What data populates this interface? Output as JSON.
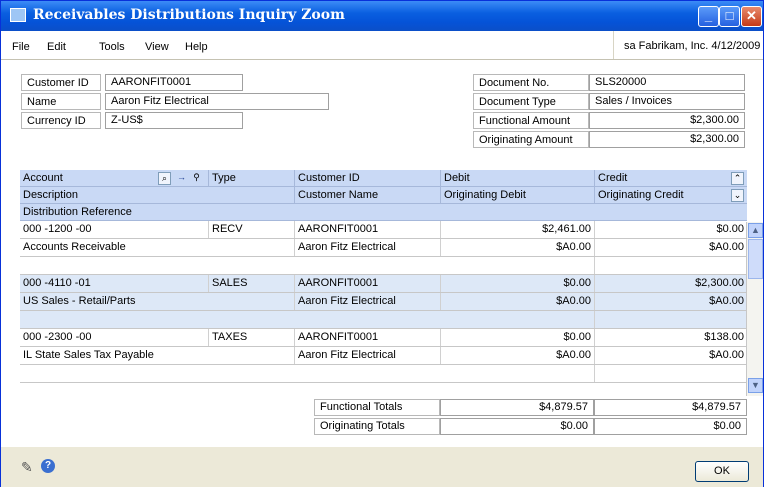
{
  "window": {
    "title": "Receivables Distributions Inquiry Zoom",
    "company_date": "sa  Fabrikam, Inc.  4/12/2009"
  },
  "menu": [
    "File",
    "Edit",
    "Tools",
    "View",
    "Help"
  ],
  "header_left": {
    "customer_id_label": "Customer ID",
    "customer_id": "AARONFIT0001",
    "name_label": "Name",
    "name": "Aaron Fitz Electrical",
    "currency_label": "Currency ID",
    "currency": "Z-US$"
  },
  "header_right": {
    "doc_no_label": "Document No.",
    "doc_no": "SLS20000",
    "doc_type_label": "Document Type",
    "doc_type": "Sales / Invoices",
    "func_label": "Functional Amount",
    "func": "$2,300.00",
    "orig_label": "Originating Amount",
    "orig": "$2,300.00"
  },
  "columns": {
    "account": "Account",
    "type": "Type",
    "customer_id": "Customer ID",
    "debit": "Debit",
    "credit": "Credit",
    "description": "Description",
    "customer_name": "Customer Name",
    "orig_debit": "Originating Debit",
    "orig_credit": "Originating Credit",
    "dist_ref": "Distribution Reference"
  },
  "rows": [
    {
      "account": "000 -1200 -00",
      "type": "RECV",
      "customer_id": "AARONFIT0001",
      "debit": "$2,461.00",
      "credit": "$0.00",
      "description": "Accounts Receivable",
      "customer_name": "Aaron Fitz Electrical",
      "orig_debit": "$A0.00",
      "orig_credit": "$A0.00"
    },
    {
      "account": "000 -4110 -01",
      "type": "SALES",
      "customer_id": "AARONFIT0001",
      "debit": "$0.00",
      "credit": "$2,300.00",
      "description": "US Sales - Retail/Parts",
      "customer_name": "Aaron Fitz Electrical",
      "orig_debit": "$A0.00",
      "orig_credit": "$A0.00"
    },
    {
      "account": "000 -2300 -00",
      "type": "TAXES",
      "customer_id": "AARONFIT0001",
      "debit": "$0.00",
      "credit": "$138.00",
      "description": "IL State Sales Tax Payable",
      "customer_name": "Aaron Fitz Electrical",
      "orig_debit": "$A0.00",
      "orig_credit": "$A0.00"
    }
  ],
  "totals": {
    "functional_label": "Functional Totals",
    "functional_debit": "$4,879.57",
    "functional_credit": "$4,879.57",
    "originating_label": "Originating Totals",
    "originating_debit": "$0.00",
    "originating_credit": "$0.00"
  },
  "buttons": {
    "ok": "OK"
  },
  "colors": {
    "titlebar": "#0553d8",
    "header_row": "#c9d9f5",
    "separator_row": "#dde8f7"
  }
}
